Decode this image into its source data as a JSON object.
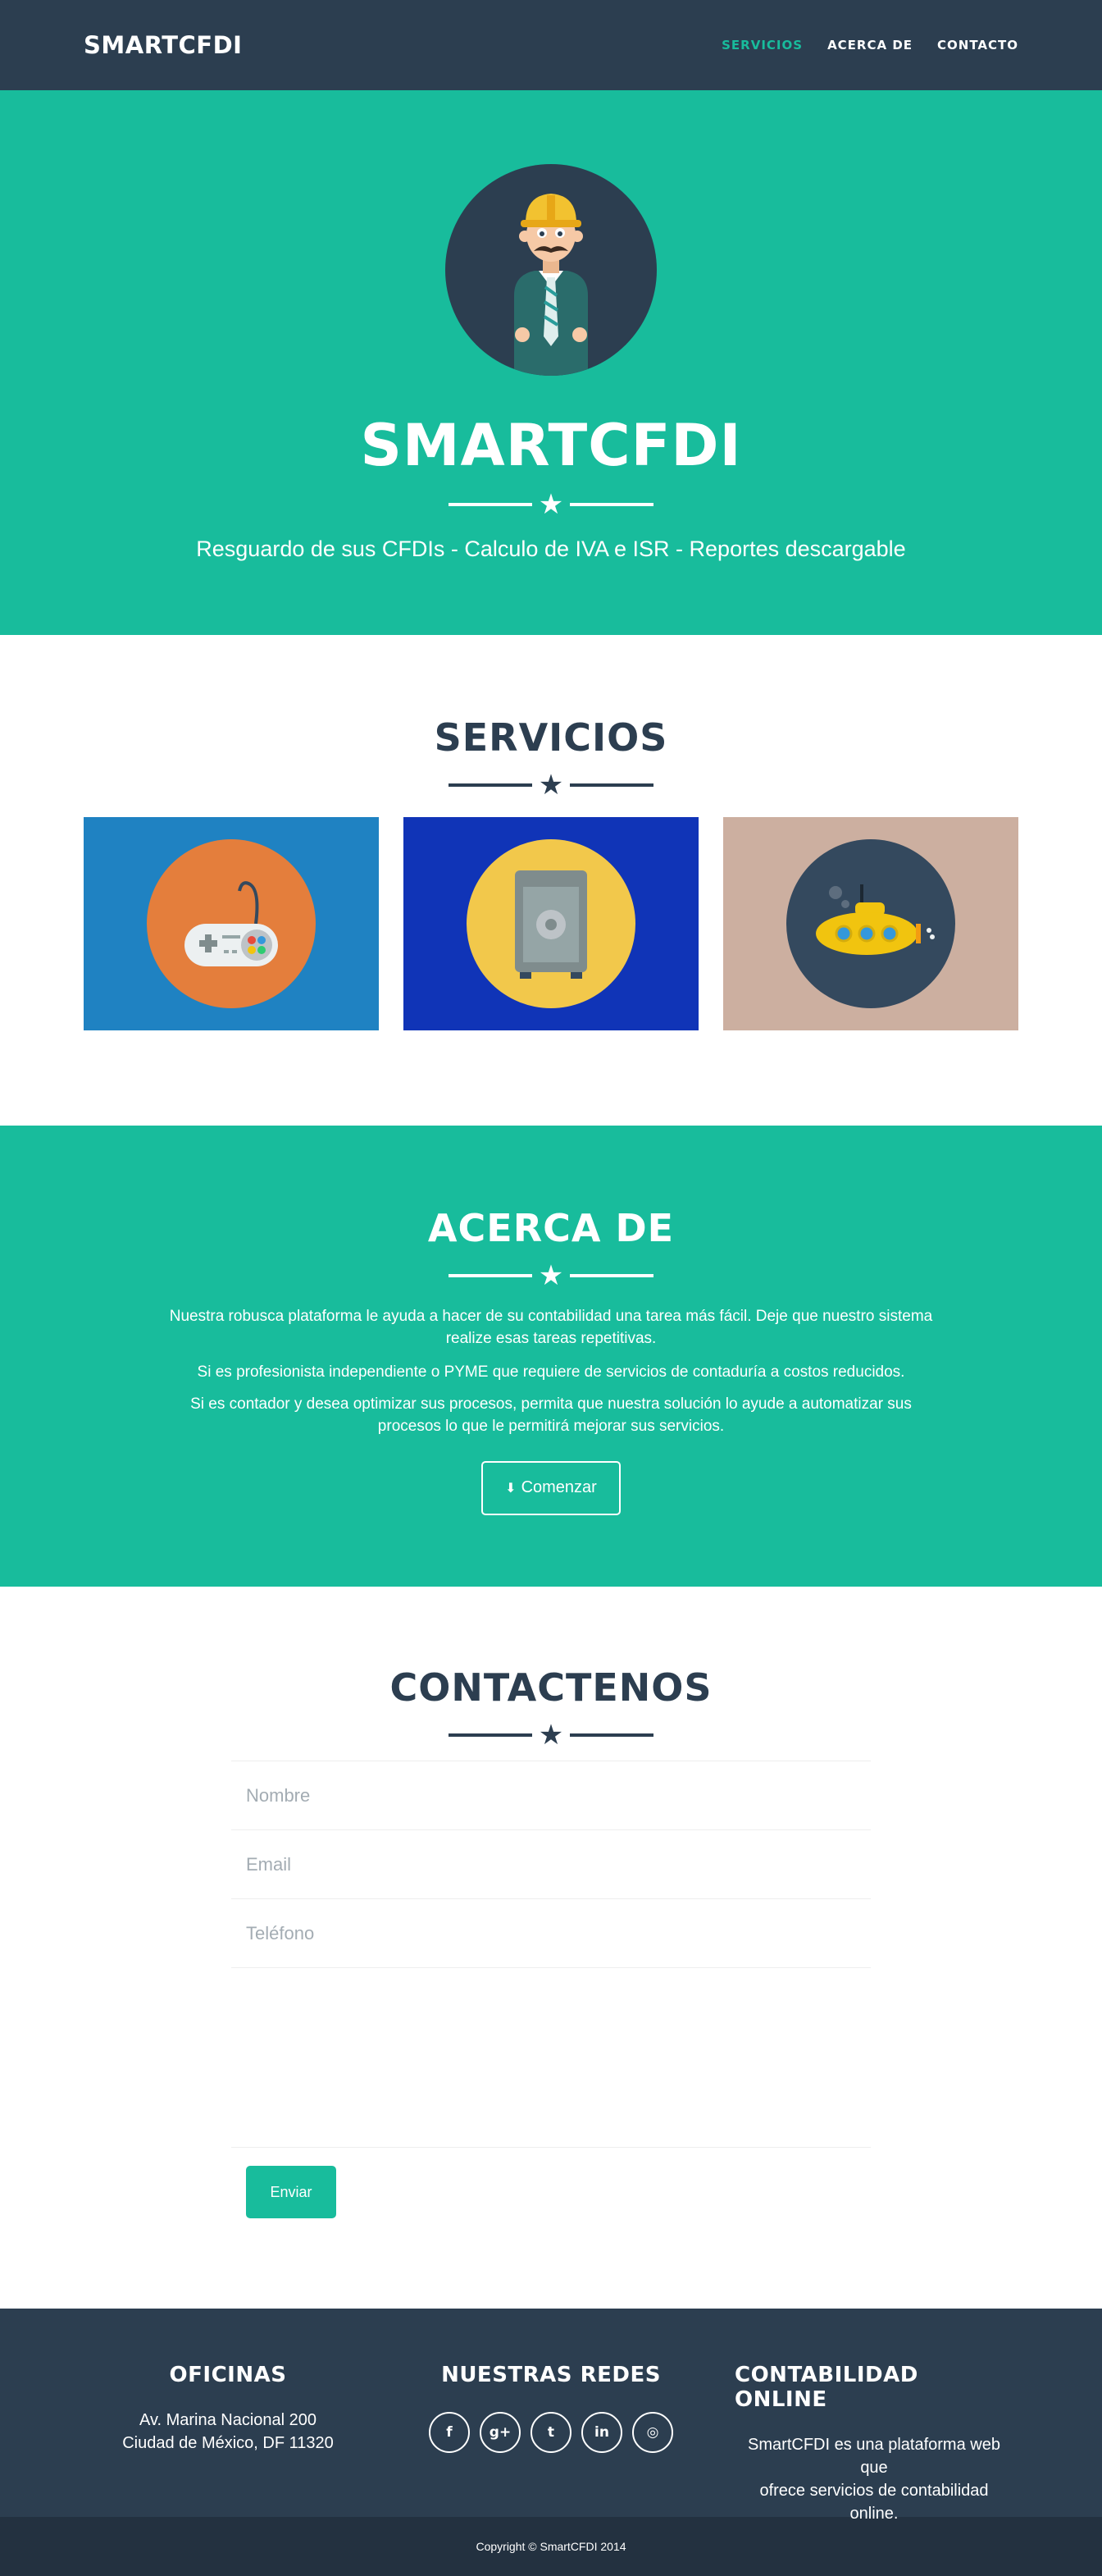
{
  "nav": {
    "brand": "SMARTCFDI",
    "links": [
      "SERVICIOS",
      "ACERCA DE",
      "CONTACTO"
    ]
  },
  "hero": {
    "title": "SMARTCFDI",
    "subtitle": "Resguardo de sus CFDIs - Calculo de IVA e ISR - Reportes descargable"
  },
  "servicios": {
    "title": "SERVICIOS",
    "cards": [
      {
        "icon": "game-controller-icon",
        "bg": "#1f82c2",
        "circle": "#e47e3c"
      },
      {
        "icon": "safe-icon",
        "bg": "#1034b7",
        "circle": "#f2c84b"
      },
      {
        "icon": "submarine-icon",
        "bg": "#ccafa0",
        "circle": "#34495e"
      }
    ]
  },
  "acerca": {
    "title": "ACERCA DE",
    "p1": "Nuestra robusca plataforma le ayuda a hacer de su contabilidad una tarea más fácil. Deje que nuestro sistema realize esas tareas repetitivas.",
    "p2": "Si es profesionista independiente o PYME que requiere de servicios de contaduría a costos reducidos.",
    "p3": "Si es contador y desea optimizar sus procesos, permita que nuestra solución lo ayude a automatizar sus procesos lo que le permitirá mejorar sus servicios.",
    "button": "Comenzar"
  },
  "contact": {
    "title": "CONTACTENOS",
    "fields": {
      "name": "Nombre",
      "email": "Email",
      "phone": "Teléfono"
    },
    "submit": "Enviar"
  },
  "footer": {
    "offices_title": "OFICINAS",
    "address1": "Av. Marina Nacional 200",
    "address2": "Ciudad de México, DF 11320",
    "social_title": "NUESTRAS REDES",
    "socials": [
      "facebook-icon",
      "google-plus-icon",
      "twitter-icon",
      "linkedin-icon",
      "dribbble-icon"
    ],
    "online_title": "CONTABILIDAD ONLINE",
    "online_text1": "SmartCFDI es una plataforma web que",
    "online_text2": "ofrece servicios de contabilidad online.",
    "copyright": "Copyright © SmartCFDI 2014"
  },
  "colors": {
    "primary": "#2c3e50",
    "accent": "#18bc9c"
  }
}
